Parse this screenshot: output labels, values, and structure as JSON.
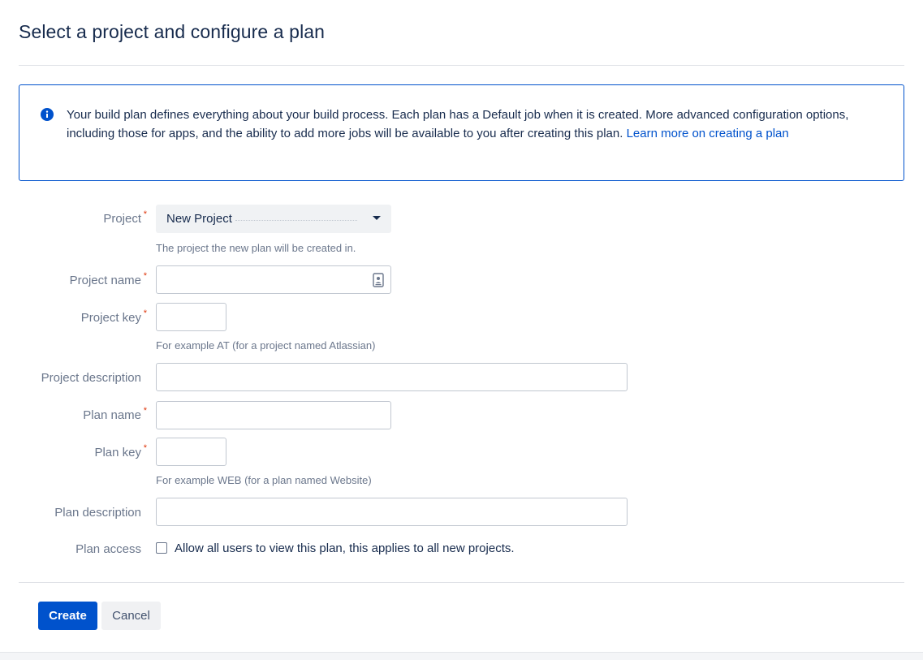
{
  "page": {
    "title": "Select a project and configure a plan"
  },
  "info": {
    "text": "Your build plan defines everything about your build process. Each plan has a Default job when it is created. More advanced configuration options, including those for apps, and the ability to add more jobs will be available to you after creating this plan. ",
    "link_text": "Learn more on creating a plan",
    "icon": "info-icon"
  },
  "form": {
    "required_marker": "*",
    "project": {
      "label": "Project",
      "selected": "New Project",
      "help": "The project the new plan will be created in."
    },
    "project_name": {
      "label": "Project name",
      "value": "",
      "icon": "contact-card-icon"
    },
    "project_key": {
      "label": "Project key",
      "value": "",
      "help": "For example AT (for a project named Atlassian)"
    },
    "project_description": {
      "label": "Project description",
      "value": ""
    },
    "plan_name": {
      "label": "Plan name",
      "value": ""
    },
    "plan_key": {
      "label": "Plan key",
      "value": "",
      "help": "For example WEB (for a plan named Website)"
    },
    "plan_description": {
      "label": "Plan description",
      "value": ""
    },
    "plan_access": {
      "label": "Plan access",
      "checkbox_label": "Allow all users to view this plan, this applies to all new projects.",
      "checked": false
    }
  },
  "actions": {
    "create_label": "Create",
    "cancel_label": "Cancel"
  },
  "colors": {
    "primary": "#0052cc",
    "required": "#de350b",
    "label": "#6b778c",
    "text": "#172b4d"
  }
}
